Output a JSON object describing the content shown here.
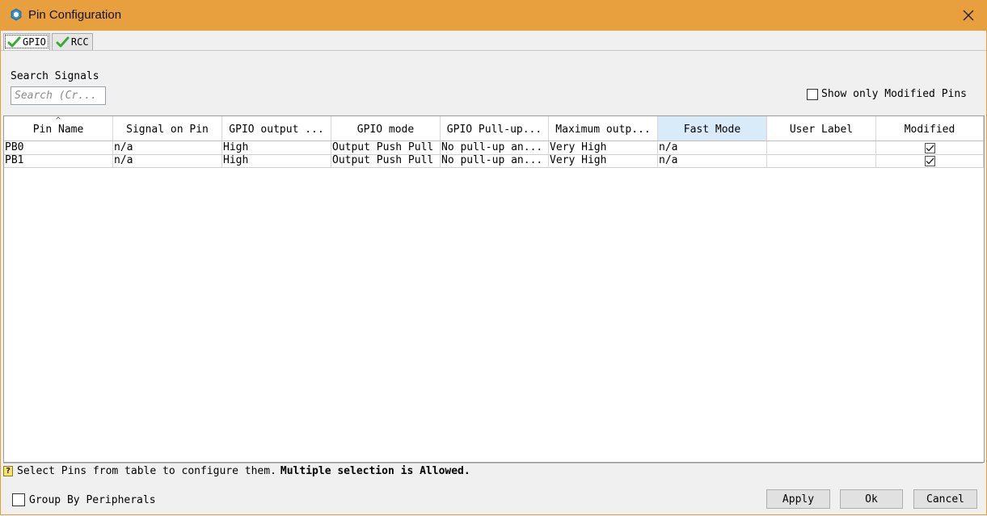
{
  "window": {
    "title": "Pin Configuration"
  },
  "tabs": [
    {
      "label": "GPIO",
      "active": true
    },
    {
      "label": "RCC",
      "active": false
    }
  ],
  "search": {
    "label": "Search Signals",
    "placeholder": "Search (Cr..."
  },
  "filters": {
    "show_modified_label": "Show only Modified Pins",
    "show_modified_checked": false
  },
  "table": {
    "columns": [
      "Pin Name",
      "Signal on Pin",
      "GPIO output ...",
      "GPIO mode",
      "GPIO Pull-up...",
      "Maximum outp...",
      "Fast Mode",
      "User Label",
      "Modified"
    ],
    "selected_column": "Fast Mode",
    "rows": [
      {
        "pin": "PB0",
        "signal": "n/a",
        "output": "High",
        "mode": "Output Push Pull",
        "pull": "No pull-up an...",
        "speed": "Very High",
        "fast": "n/a",
        "label": "",
        "modified": true
      },
      {
        "pin": "PB1",
        "signal": "n/a",
        "output": "High",
        "mode": "Output Push Pull",
        "pull": "No pull-up an...",
        "speed": "Very High",
        "fast": "n/a",
        "label": "",
        "modified": true
      }
    ]
  },
  "status": {
    "text": "Select Pins from table to configure them.",
    "bold_text": "Multiple selection is Allowed."
  },
  "footer": {
    "group_by_label": "Group By Peripherals",
    "group_by_checked": false,
    "apply_label": "Apply",
    "ok_label": "Ok",
    "cancel_label": "Cancel"
  },
  "colors": {
    "titlebar": "#e8a03f",
    "selected_header": "#d9ebf9",
    "check": "#3aaa35"
  }
}
